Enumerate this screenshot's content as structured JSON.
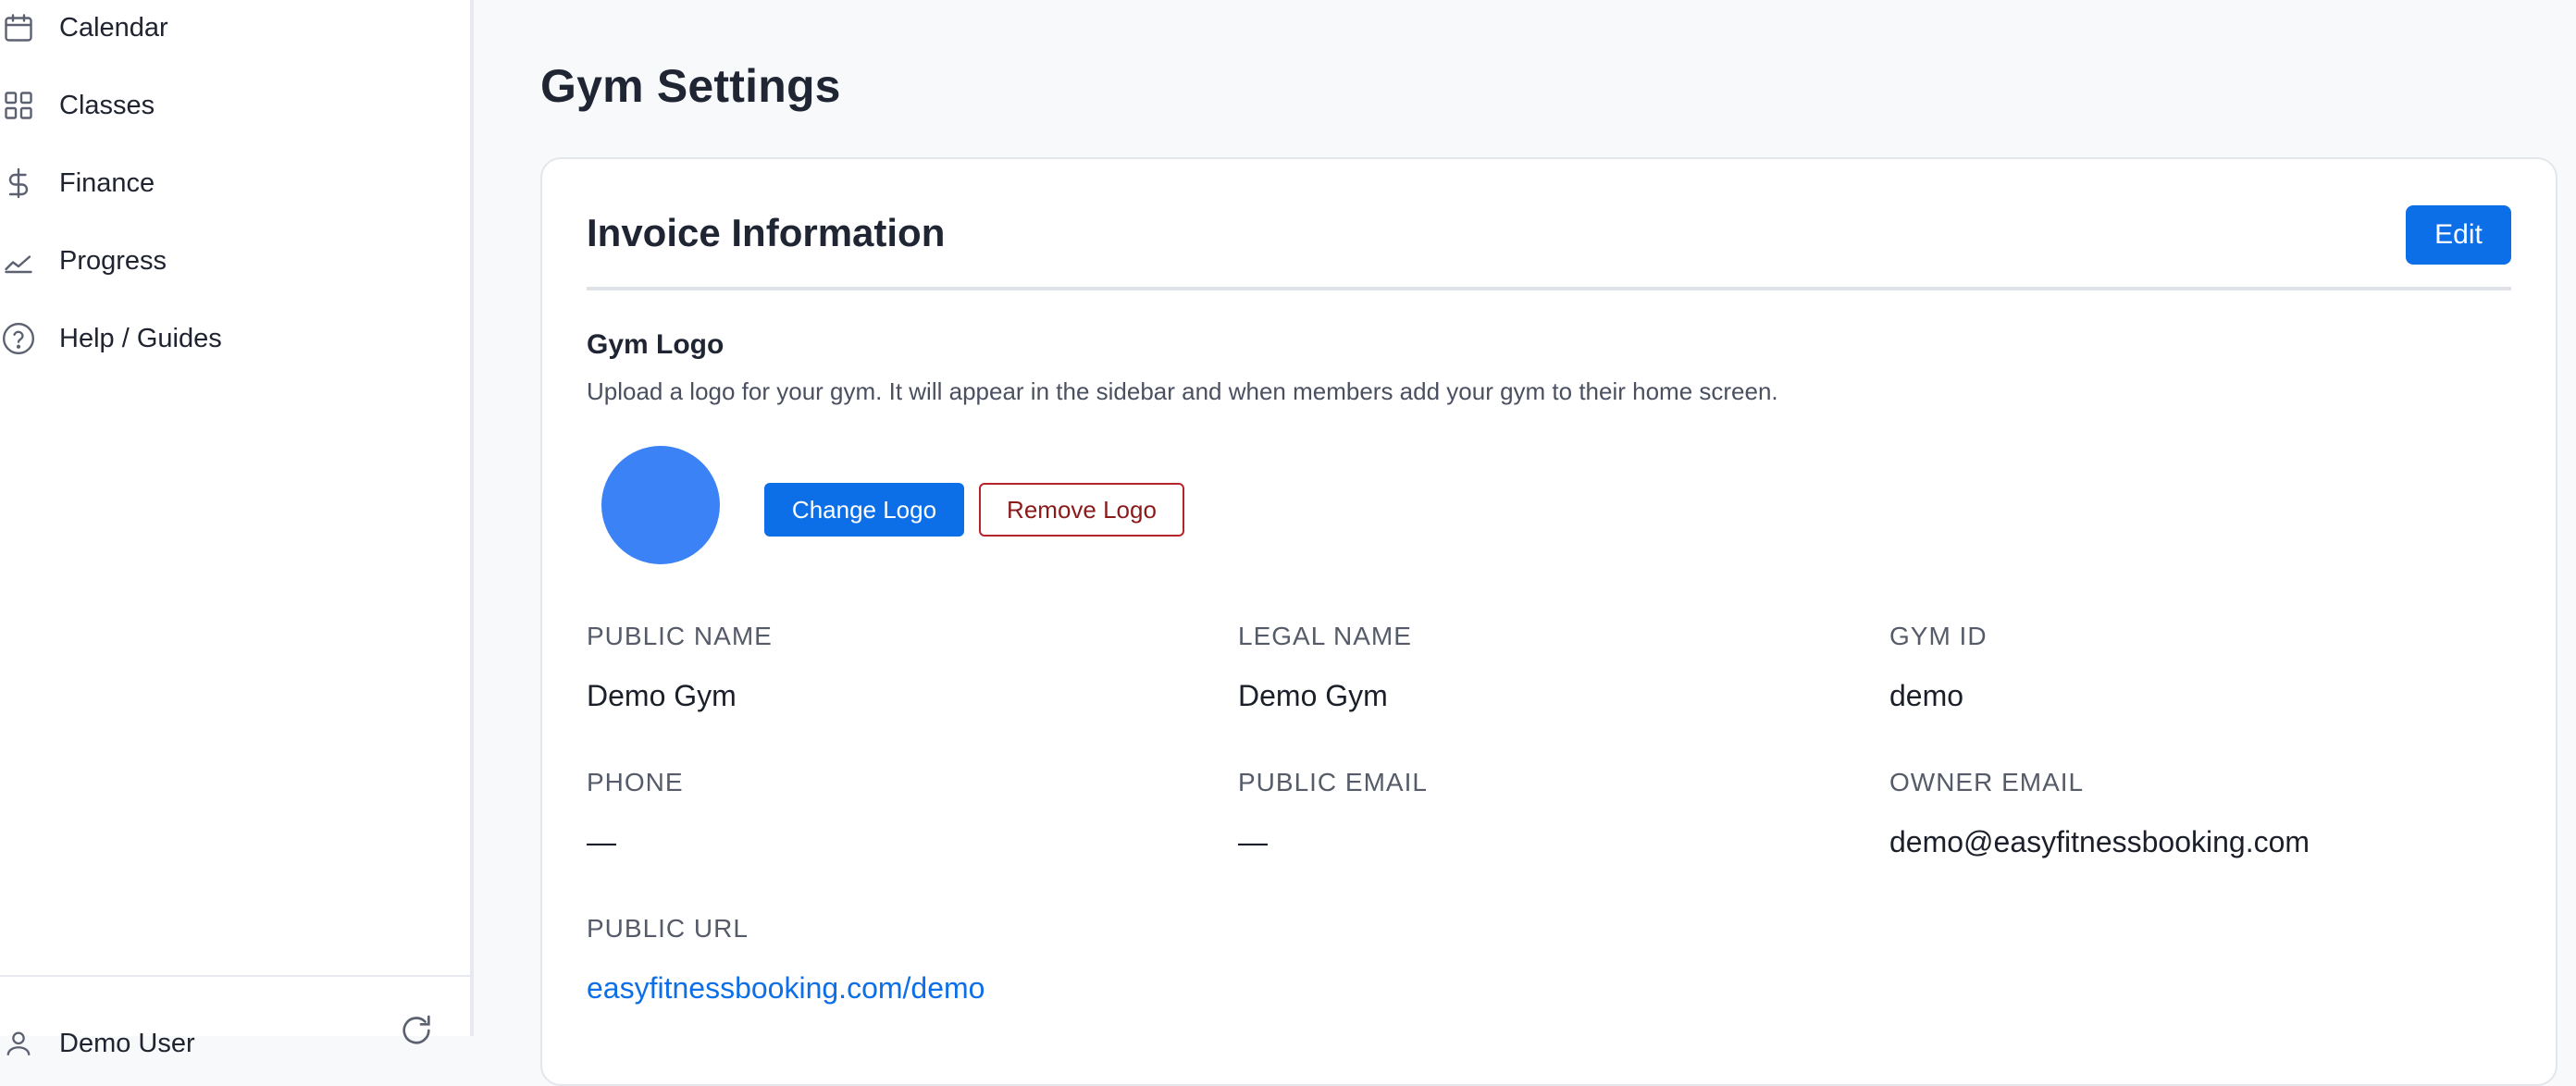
{
  "sidebar": {
    "items": [
      {
        "label": "Calendar",
        "icon": "calendar-icon"
      },
      {
        "label": "Classes",
        "icon": "grid-icon"
      },
      {
        "label": "Finance",
        "icon": "dollar-icon"
      },
      {
        "label": "Progress",
        "icon": "chart-line-icon"
      },
      {
        "label": "Help / Guides",
        "icon": "help-circle-icon"
      }
    ],
    "user": {
      "name": "Demo User",
      "icon": "user-icon",
      "action_icon": "refresh-icon"
    }
  },
  "page": {
    "title": "Gym Settings"
  },
  "invoice": {
    "title": "Invoice Information",
    "edit_label": "Edit",
    "logo_section": {
      "title": "Gym Logo",
      "description": "Upload a logo for your gym. It will appear in the sidebar and when members add your gym to their home screen.",
      "change_label": "Change Logo",
      "remove_label": "Remove Logo",
      "logo_color": "#3b82f6"
    },
    "fields": {
      "public_name": {
        "label": "PUBLIC NAME",
        "value": "Demo Gym"
      },
      "legal_name": {
        "label": "LEGAL NAME",
        "value": "Demo Gym"
      },
      "gym_id": {
        "label": "GYM ID",
        "value": "demo"
      },
      "phone": {
        "label": "PHONE",
        "value": "—"
      },
      "public_email": {
        "label": "PUBLIC EMAIL",
        "value": "—"
      },
      "owner_email": {
        "label": "OWNER EMAIL",
        "value": "demo@easyfitnessbooking.com"
      },
      "public_url": {
        "label": "PUBLIC URL",
        "value": "easyfitnessbooking.com/demo"
      }
    }
  },
  "colors": {
    "primary": "#0d6fe8",
    "danger": "#b5232b",
    "text": "#1f2533",
    "muted": "#555b68"
  }
}
